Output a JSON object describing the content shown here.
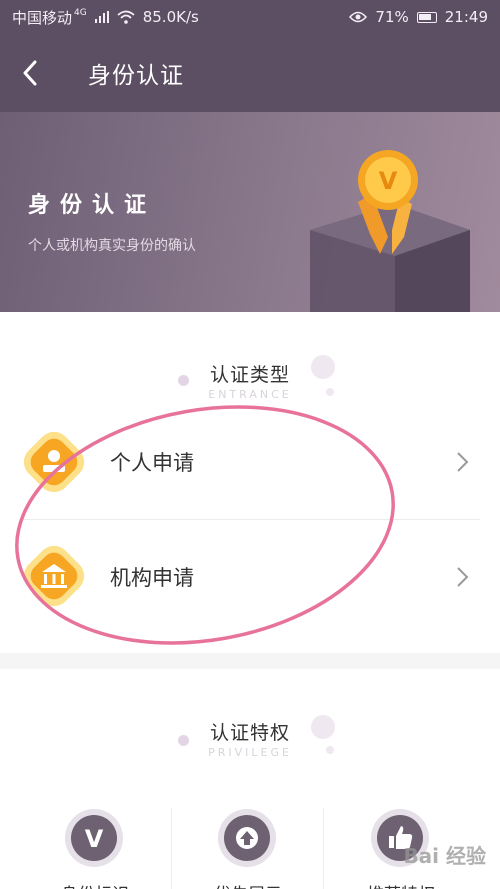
{
  "status_bar": {
    "carrier": "中国移动",
    "network": "4G",
    "speed": "85.0K/s",
    "battery": "71%",
    "time": "21:49"
  },
  "nav": {
    "title": "身份认证"
  },
  "banner": {
    "title": "身份认证",
    "subtitle": "个人或机构真实身份的确认"
  },
  "auth_type": {
    "title": "认证类型",
    "subtitle": "ENTRANCE",
    "items": [
      {
        "label": "个人申请",
        "icon": "person-card-icon"
      },
      {
        "label": "机构申请",
        "icon": "institution-icon"
      }
    ]
  },
  "privilege": {
    "title": "认证特权",
    "subtitle": "PRIVILEGE",
    "items": [
      {
        "label": "身份标识",
        "icon": "v-badge-icon"
      },
      {
        "label": "优先展示",
        "icon": "arrow-up-icon"
      },
      {
        "label": "推荐特权",
        "icon": "thumbs-up-icon"
      }
    ]
  },
  "watermark": "Bai 经验",
  "colors": {
    "header_bg": "#5c4f63",
    "accent_orange": "#f6a623",
    "annotation": "#e8739a",
    "privilege_icon": "#6d6172"
  }
}
